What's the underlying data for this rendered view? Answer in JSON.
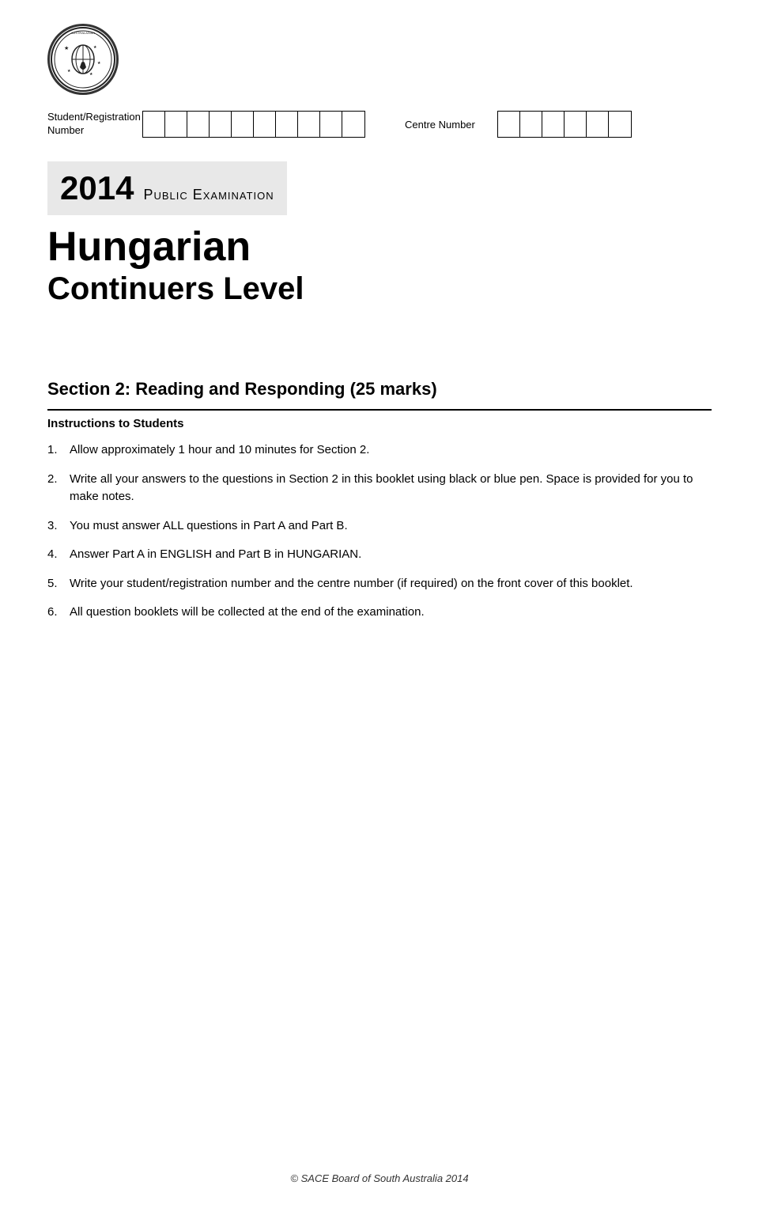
{
  "logo": {
    "alt": "Australasian Curriculum Assessment and Certification Authorities logo"
  },
  "registration": {
    "label": "Student/Registration\nNumber",
    "student_boxes": 10,
    "centre_label": "Centre Number",
    "centre_boxes": 6
  },
  "exam": {
    "year": "2014",
    "type": "Public Examination",
    "subject": "Hungarian",
    "level": "Continuers Level"
  },
  "section": {
    "title": "Section 2: Reading and Responding (25 marks)",
    "instructions_heading": "Instructions to Students",
    "instructions": [
      {
        "num": "1.",
        "text": "Allow approximately 1 hour and 10 minutes for Section 2."
      },
      {
        "num": "2.",
        "text": "Write all your answers to the questions in Section 2 in this booklet using black or blue pen. Space is provided for you to make notes."
      },
      {
        "num": "3.",
        "text": "You must answer ALL questions in Part A and Part B."
      },
      {
        "num": "4.",
        "text": "Answer Part A in ENGLISH and Part B in HUNGARIAN."
      },
      {
        "num": "5.",
        "text": "Write your student/registration number and the centre number (if required) on the front cover of this booklet."
      },
      {
        "num": "6.",
        "text": "All question booklets will be collected at the end of the examination."
      }
    ]
  },
  "footer": {
    "text": "© SACE Board of South Australia 2014"
  }
}
